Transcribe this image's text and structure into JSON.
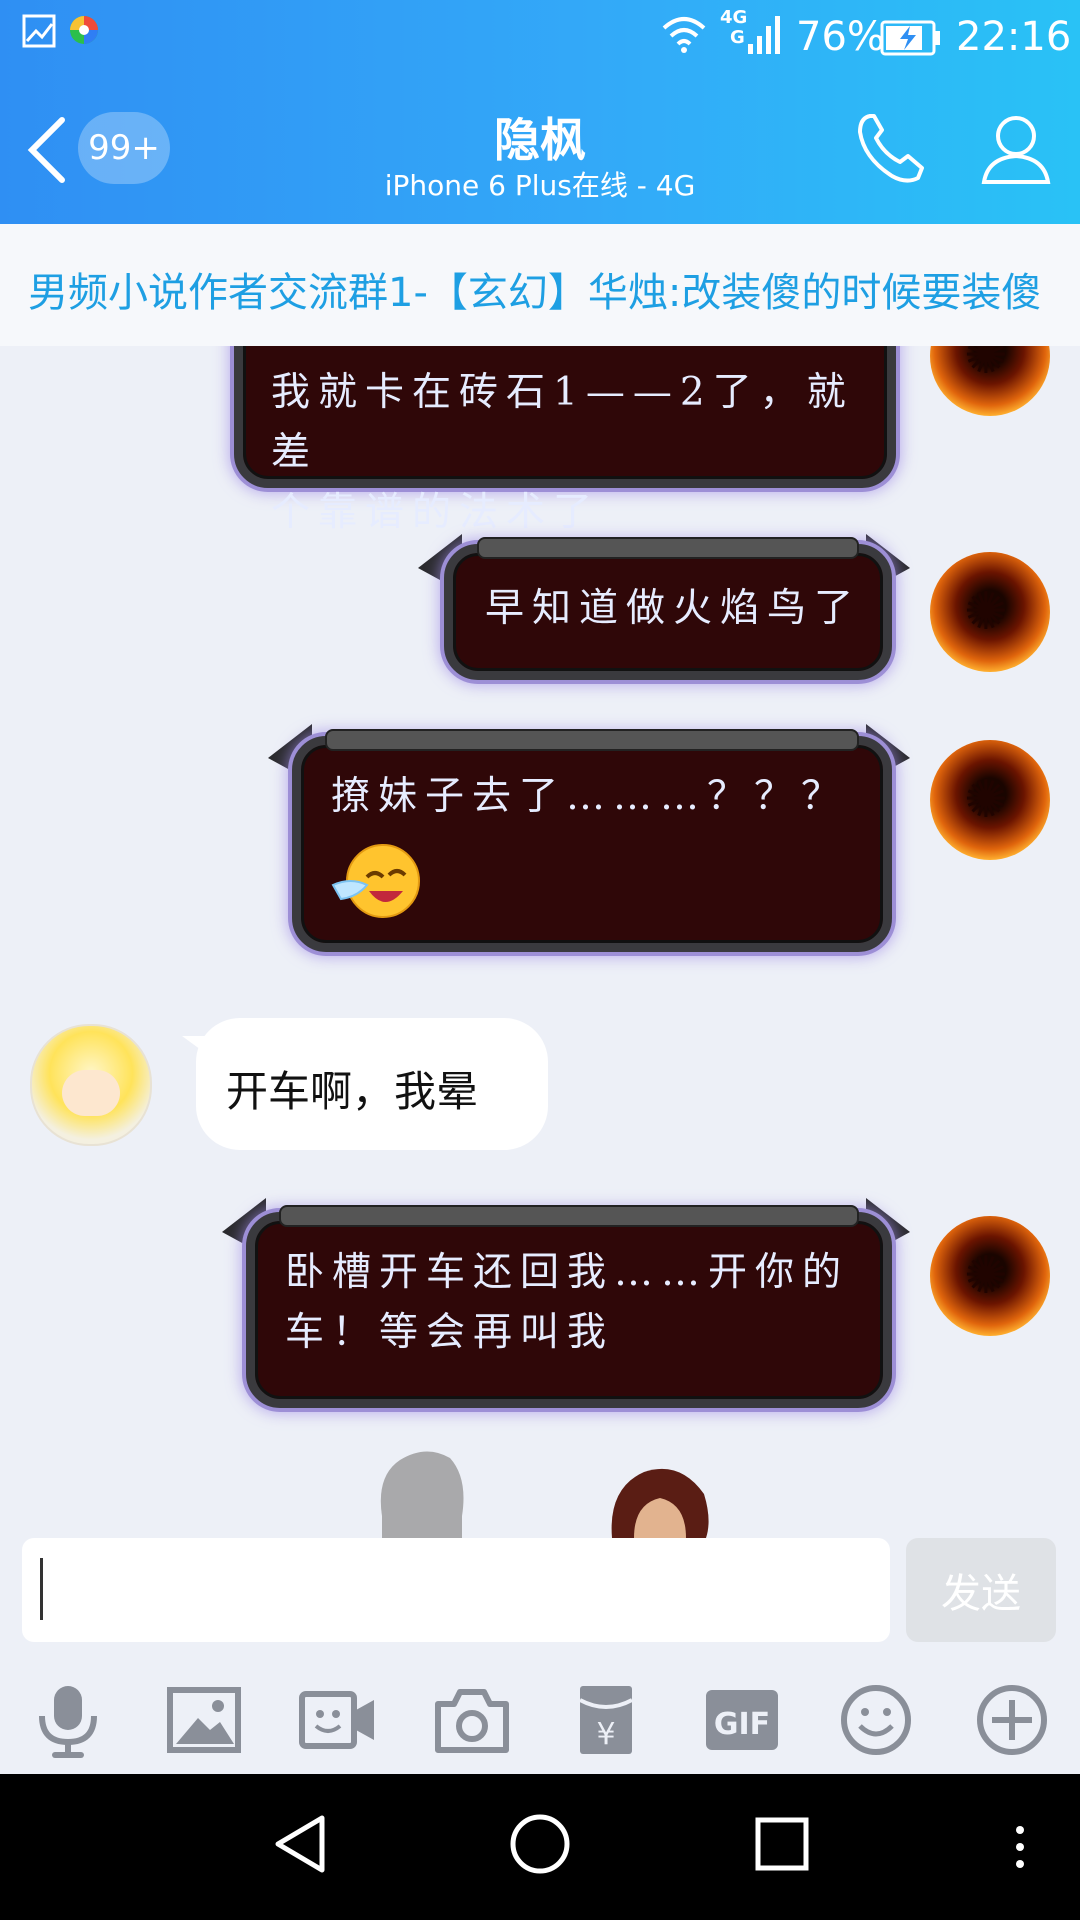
{
  "status_bar": {
    "network_top": "4G",
    "network_bottom": "G",
    "battery": "76%",
    "time": "22:16"
  },
  "header": {
    "unread_count": "99+",
    "contact_name": "隐枫",
    "contact_status": "iPhone 6 Plus在线 - 4G"
  },
  "notice": {
    "text": "男频小说作者交流群1-【玄幻】华烛:改装傻的时候要装傻"
  },
  "messages": [
    {
      "side": "right",
      "style": "dark",
      "lines": [
        "我就卡在砖石1——2了，就差",
        "个靠谱的法术了"
      ]
    },
    {
      "side": "right",
      "style": "dark",
      "lines": [
        "早知道做火焰鸟了"
      ]
    },
    {
      "side": "right",
      "style": "dark",
      "lines": [
        "撩妹子去了………？？？"
      ],
      "emoji": "crying-laughing-face"
    },
    {
      "side": "left",
      "style": "white",
      "lines": [
        "开车啊，我晕"
      ]
    },
    {
      "side": "right",
      "style": "dark",
      "lines": [
        "卧槽开车还回我……开你的",
        "车！等会再叫我"
      ]
    }
  ],
  "input": {
    "value": "",
    "send_label": "发送"
  },
  "toolbar": {
    "gif_label": "GIF",
    "icons": [
      "microphone-icon",
      "image-icon",
      "video-call-icon",
      "camera-icon",
      "red-packet-icon",
      "gif-icon",
      "emoji-icon",
      "plus-icon"
    ]
  }
}
